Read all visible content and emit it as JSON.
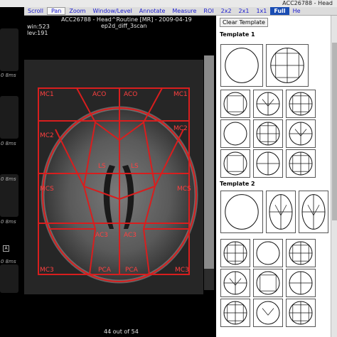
{
  "window": {
    "title": "ACC26788 - Head"
  },
  "toolbar": {
    "items": [
      {
        "label": "Scroll"
      },
      {
        "label": "Pan",
        "active": true
      },
      {
        "label": "Zoom"
      },
      {
        "label": "Window/Level"
      },
      {
        "label": "Annotate"
      },
      {
        "label": "Measure"
      },
      {
        "label": "ROI"
      },
      {
        "label": "2x2"
      },
      {
        "label": "2x1"
      },
      {
        "label": "1x1"
      },
      {
        "label": "Full"
      },
      {
        "label": "He"
      }
    ]
  },
  "left_strip": {
    "labels": [
      "0 8ms",
      "0 8ms",
      "0 8ms",
      "0 8ms",
      "0 8ms"
    ],
    "marker": "A"
  },
  "viewer": {
    "header_line1": "ACC26788 - Head^Routine [MR] - 2009-04-19",
    "header_line2": "ep2d_diff_3scan",
    "win": "win:523",
    "lev": "lev:191",
    "slice_status": "44 out of 54",
    "region_labels": [
      "MC1",
      "ACO",
      "ACO",
      "MC1",
      "MC2",
      "MC2",
      "LS",
      "LS",
      "MCS",
      "MCS",
      "AC3",
      "AC3",
      "PCA",
      "PCA",
      "MC3",
      "MC3"
    ]
  },
  "panel": {
    "clear_button": "Clear Template",
    "template1_title": "Template 1",
    "template2_title": "Template 2"
  },
  "colors": {
    "roi": "#d81e1e",
    "link": "#1a1ad0",
    "accent": "#1a4db3"
  }
}
